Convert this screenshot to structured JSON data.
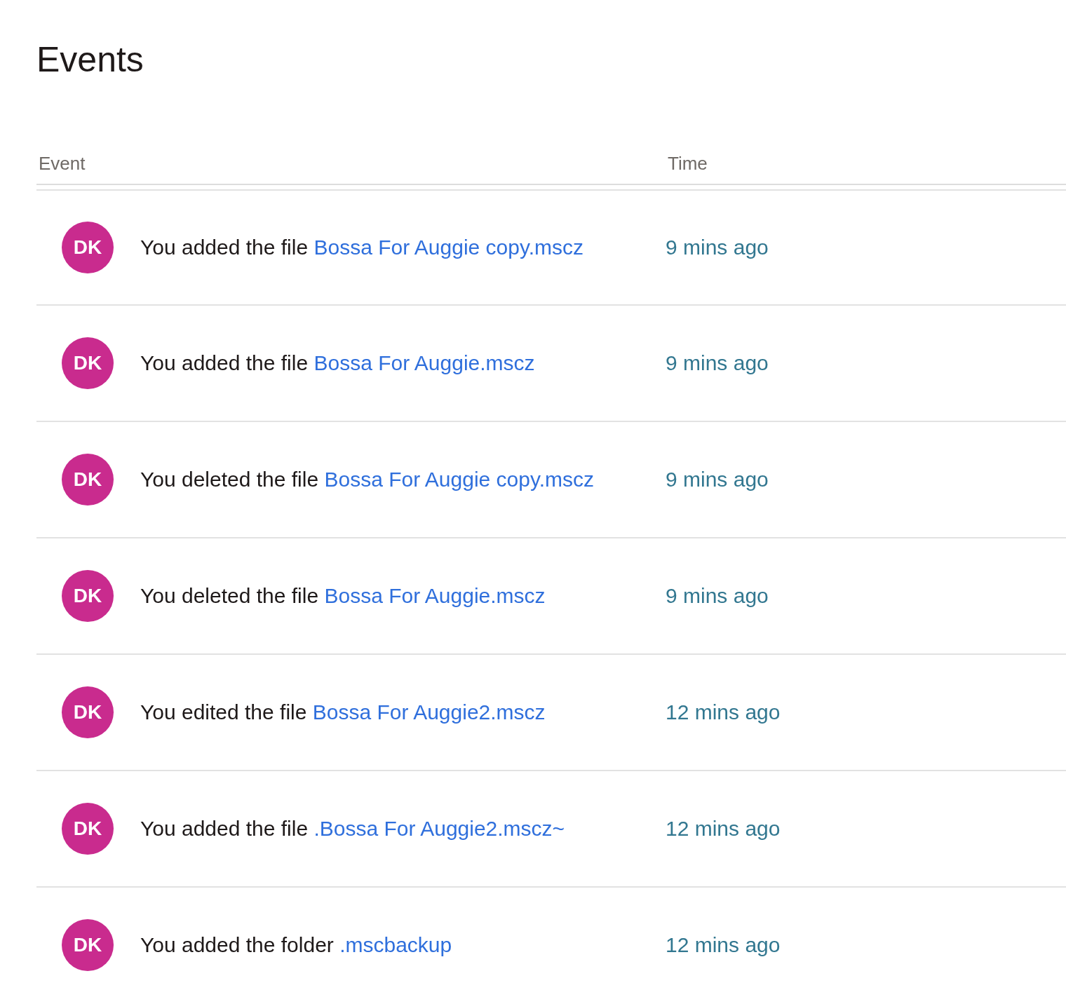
{
  "title": "Events",
  "table": {
    "columns": [
      "Event",
      "Time"
    ],
    "rows": [
      {
        "initials": "DK",
        "text": "You added the file ",
        "link": "Bossa For Auggie copy.mscz",
        "time": "9 mins ago"
      },
      {
        "initials": "DK",
        "text": "You added the file ",
        "link": "Bossa For Auggie.mscz",
        "time": "9 mins ago"
      },
      {
        "initials": "DK",
        "text": "You deleted the file ",
        "link": "Bossa For Auggie copy.mscz",
        "time": "9 mins ago"
      },
      {
        "initials": "DK",
        "text": "You deleted the file ",
        "link": "Bossa For Auggie.mscz",
        "time": "9 mins ago"
      },
      {
        "initials": "DK",
        "text": "You edited the file ",
        "link": "Bossa For Auggie2.mscz",
        "time": "12 mins ago"
      },
      {
        "initials": "DK",
        "text": "You added the file ",
        "link": ".Bossa For Auggie2.mscz~",
        "time": "12 mins ago"
      },
      {
        "initials": "DK",
        "text": "You added the folder ",
        "link": ".mscbackup",
        "time": "12 mins ago"
      }
    ]
  }
}
